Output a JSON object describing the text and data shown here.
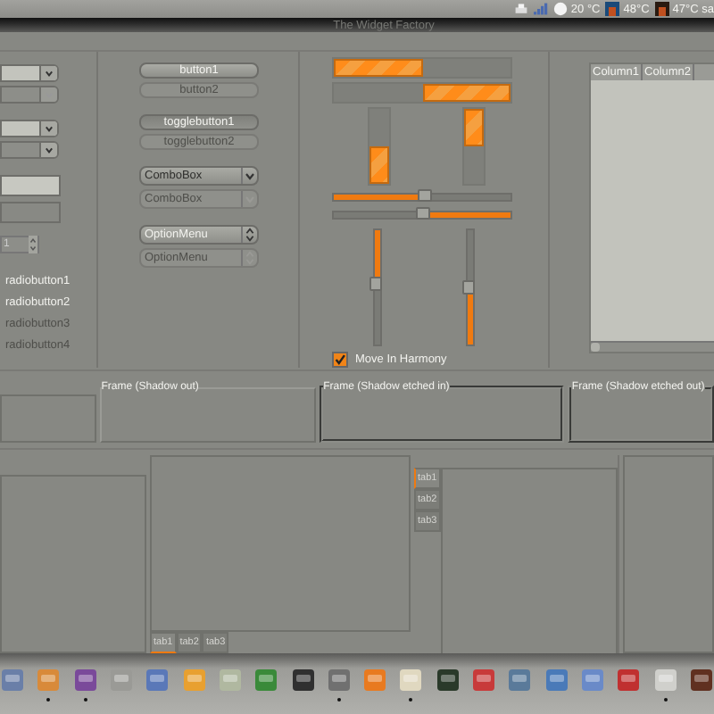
{
  "top_panel": {
    "tray": [
      {
        "kind": "weather",
        "text": "20 °C"
      },
      {
        "kind": "cpu",
        "text": "48°C"
      },
      {
        "kind": "gpu",
        "text": "47°C sa"
      }
    ]
  },
  "window": {
    "title": "The Widget Factory"
  },
  "left_column": {
    "combo_entries": [
      {
        "editable": true,
        "disabled": false
      },
      {
        "editable": true,
        "disabled": true
      },
      {
        "editable": true,
        "disabled": false
      },
      {
        "editable": false,
        "disabled": false
      }
    ],
    "entries": [
      {
        "disabled": false
      },
      {
        "disabled": true
      }
    ],
    "spin": {
      "value": "1"
    },
    "radios": [
      {
        "label": "radiobutton1",
        "disabled": false
      },
      {
        "label": "radiobutton2",
        "disabled": false
      },
      {
        "label": "radiobutton3",
        "disabled": true
      },
      {
        "label": "radiobutton4",
        "disabled": true
      }
    ]
  },
  "buttons": [
    {
      "label": "button1",
      "disabled": false
    },
    {
      "label": "button2",
      "disabled": true
    }
  ],
  "toggle_buttons": [
    {
      "label": "togglebutton1",
      "on": true,
      "disabled": false
    },
    {
      "label": "togglebutton2",
      "on": false,
      "disabled": true
    }
  ],
  "combo_boxes": [
    {
      "label": "ComboBox",
      "disabled": false
    },
    {
      "label": "ComboBox",
      "disabled": true
    }
  ],
  "option_menus": [
    {
      "label": "OptionMenu",
      "disabled": false
    },
    {
      "label": "OptionMenu",
      "disabled": true
    }
  ],
  "horizontal_progress_bars": [
    {
      "level": 0.5,
      "inverted": false
    },
    {
      "level": 0.5,
      "inverted": true
    }
  ],
  "vertical_progress_bars": [
    {
      "level": 0.5,
      "inverted": false
    },
    {
      "level": 0.5,
      "inverted": true
    }
  ],
  "horizontal_scales": [
    {
      "level": 0.52,
      "inverted": false
    },
    {
      "level": 0.5,
      "inverted": true
    }
  ],
  "vertical_scales": [
    {
      "level": 0.47,
      "inverted": true
    },
    {
      "level": 0.5,
      "inverted": false
    }
  ],
  "checkbox": {
    "label": "Move In Harmony",
    "checked": true
  },
  "tree_view": {
    "columns": [
      "Column1",
      "Column2"
    ]
  },
  "frames": [
    {
      "kind": "in"
    },
    {
      "kind": "out",
      "label": "Frame (Shadow out)"
    },
    {
      "kind": "etched_in",
      "label": "Frame (Shadow etched in)"
    },
    {
      "kind": "etched_out",
      "label": "Frame (Shadow etched out)"
    }
  ],
  "notebooks": [
    {
      "kind": "bottom",
      "tabs": [
        {
          "label": "tab1",
          "selected": true
        },
        {
          "label": "tab2",
          "selected": false
        },
        {
          "label": "tab3",
          "selected": false
        }
      ]
    },
    {
      "kind": "left",
      "tabs": [
        {
          "label": "tab1",
          "selected": true
        },
        {
          "label": "tab2",
          "selected": false
        },
        {
          "label": "tab3",
          "selected": false
        }
      ]
    }
  ],
  "dock": {
    "items": [
      {
        "running": false
      },
      {
        "running": true
      },
      {
        "running": true
      },
      {
        "running": false
      },
      {
        "running": false
      },
      {
        "running": false
      },
      {
        "running": false
      },
      {
        "running": false
      },
      {
        "running": false
      },
      {
        "running": true
      },
      {
        "running": false
      },
      {
        "running": true
      },
      {
        "running": false
      },
      {
        "running": false
      },
      {
        "running": false
      },
      {
        "running": false
      },
      {
        "running": false
      },
      {
        "running": false
      },
      {
        "running": true
      },
      {
        "running": false
      }
    ]
  }
}
